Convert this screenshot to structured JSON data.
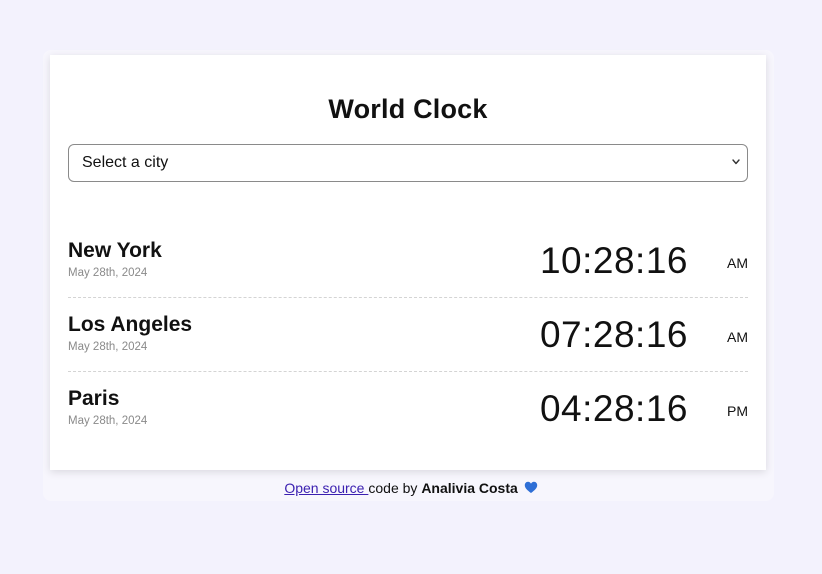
{
  "page": {
    "title": "World Clock"
  },
  "select": {
    "label": "Select a city"
  },
  "clocks": [
    {
      "city": "New York",
      "date": "May 28th, 2024",
      "time": "10:28:16",
      "ampm": "AM"
    },
    {
      "city": "Los Angeles",
      "date": "May 28th, 2024",
      "time": "07:28:16",
      "ampm": "AM"
    },
    {
      "city": "Paris",
      "date": "May 28th, 2024",
      "time": "04:28:16",
      "ampm": "PM"
    }
  ],
  "footer": {
    "link_text": "Open source ",
    "middle_text": "code by ",
    "author": "Analivia Costa"
  },
  "colors": {
    "background": "#f3f2fd",
    "card": "#ffffff",
    "link": "#3a1fb0",
    "heart": "#2f6fd6",
    "date_text": "#8a8a8a"
  },
  "icons": {
    "select_chevron": "chevron-down-icon",
    "footer_heart": "blue-heart-icon"
  }
}
